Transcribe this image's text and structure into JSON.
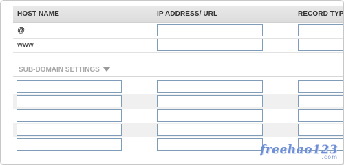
{
  "table": {
    "columns": {
      "host_name": "HOST NAME",
      "ip_address_url": "IP ADDRESS/ URL",
      "record_type": "RECORD TYP"
    },
    "rows": [
      {
        "host": "@"
      },
      {
        "host": "www"
      }
    ]
  },
  "subdomain": {
    "title": "SUB-DOMAIN SETTINGS",
    "toggle_icon": "chevron-down-icon",
    "rows": 5
  },
  "watermark": {
    "main": "freehao123",
    "sub": ".com"
  }
}
